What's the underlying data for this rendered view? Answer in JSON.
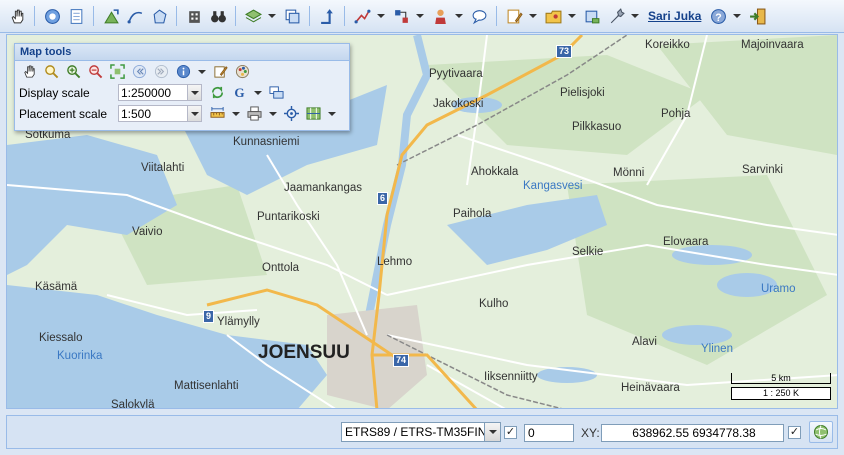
{
  "toolbar": {
    "user_name": "Sari Juka"
  },
  "map_tools": {
    "title": "Map tools",
    "display_scale_label": "Display scale",
    "display_scale_value": "1:250000",
    "placement_scale_label": "Placement scale",
    "placement_scale_value": "1:500"
  },
  "map": {
    "places": [
      {
        "name": "Koreikko",
        "kind": "place"
      },
      {
        "name": "Majoinvaara",
        "kind": "place"
      },
      {
        "name": "Pyytivaara",
        "kind": "place"
      },
      {
        "name": "Jakokoski",
        "kind": "place"
      },
      {
        "name": "Pielisjoki",
        "kind": "place"
      },
      {
        "name": "Pilkkasuo",
        "kind": "place"
      },
      {
        "name": "Pohja",
        "kind": "place"
      },
      {
        "name": "Sotkuma",
        "kind": "place"
      },
      {
        "name": "Kunnasniemi",
        "kind": "place"
      },
      {
        "name": "Viitalahti",
        "kind": "place"
      },
      {
        "name": "Ahokkala",
        "kind": "place"
      },
      {
        "name": "Kangasvesi",
        "kind": "water"
      },
      {
        "name": "Mönni",
        "kind": "place"
      },
      {
        "name": "Sarvinki",
        "kind": "place"
      },
      {
        "name": "Jaamankangas",
        "kind": "place"
      },
      {
        "name": "Puntarikoski",
        "kind": "place"
      },
      {
        "name": "Paihola",
        "kind": "place"
      },
      {
        "name": "Vaivio",
        "kind": "place"
      },
      {
        "name": "Elovaara",
        "kind": "place"
      },
      {
        "name": "Selkie",
        "kind": "place"
      },
      {
        "name": "Onttola",
        "kind": "place"
      },
      {
        "name": "Lehmo",
        "kind": "place"
      },
      {
        "name": "Käsämä",
        "kind": "place"
      },
      {
        "name": "Uramo",
        "kind": "water"
      },
      {
        "name": "Kulho",
        "kind": "place"
      },
      {
        "name": "Ylämylly",
        "kind": "place"
      },
      {
        "name": "Kiessalo",
        "kind": "place"
      },
      {
        "name": "Kuorinka",
        "kind": "water"
      },
      {
        "name": "JOENSUU",
        "kind": "city"
      },
      {
        "name": "Alavi",
        "kind": "place"
      },
      {
        "name": "Ylinen",
        "kind": "water"
      },
      {
        "name": "Iiksenniitty",
        "kind": "place"
      },
      {
        "name": "Mattisenlahti",
        "kind": "place"
      },
      {
        "name": "Heinävaara",
        "kind": "place"
      },
      {
        "name": "Salokylä",
        "kind": "place"
      }
    ],
    "road_numbers": [
      "73",
      "6",
      "9",
      "74"
    ],
    "scale_km": "5 km",
    "scale_ratio": "1 : 250 K"
  },
  "bottom": {
    "crs_value": "ETRS89 / ETRS-TM35FIN",
    "tolerance_value": "0",
    "xy_label": "XY:",
    "xy_value": "638962.55 6934778.38"
  },
  "colors": {
    "toolbar_bg": "#d6e3f3",
    "panel_border": "#99bbe8",
    "land": "#e4efdc",
    "forest": "#cfe3c2",
    "water": "#a9cbe8",
    "highway": "#f2b84b",
    "road": "#ffffff"
  }
}
